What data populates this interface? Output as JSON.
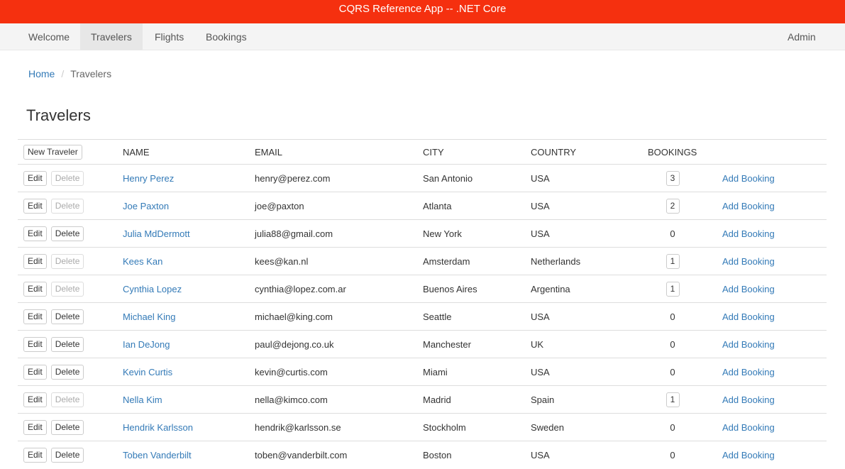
{
  "app_title": "CQRS Reference App -- .NET Core",
  "nav": {
    "items": [
      "Welcome",
      "Travelers",
      "Flights",
      "Bookings"
    ],
    "active": "Travelers",
    "user": "Admin"
  },
  "breadcrumb": {
    "home": "Home",
    "current": "Travelers"
  },
  "page_title": "Travelers",
  "table": {
    "new_button": "New Traveler",
    "headers": {
      "name": "NAME",
      "email": "EMAIL",
      "city": "CITY",
      "country": "COUNTRY",
      "bookings": "BOOKINGS"
    },
    "edit_label": "Edit",
    "delete_label": "Delete",
    "add_booking_label": "Add Booking",
    "rows": [
      {
        "name": "Henry Perez",
        "email": "henry@perez.com",
        "city": "San Antonio",
        "country": "USA",
        "bookings": "3",
        "delete_enabled": false
      },
      {
        "name": "Joe Paxton",
        "email": "joe@paxton",
        "city": "Atlanta",
        "country": "USA",
        "bookings": "2",
        "delete_enabled": false
      },
      {
        "name": "Julia MdDermott",
        "email": "julia88@gmail.com",
        "city": "New York",
        "country": "USA",
        "bookings": "0",
        "delete_enabled": true
      },
      {
        "name": "Kees Kan",
        "email": "kees@kan.nl",
        "city": "Amsterdam",
        "country": "Netherlands",
        "bookings": "1",
        "delete_enabled": false
      },
      {
        "name": "Cynthia Lopez",
        "email": "cynthia@lopez.com.ar",
        "city": "Buenos Aires",
        "country": "Argentina",
        "bookings": "1",
        "delete_enabled": false
      },
      {
        "name": "Michael King",
        "email": "michael@king.com",
        "city": "Seattle",
        "country": "USA",
        "bookings": "0",
        "delete_enabled": true
      },
      {
        "name": "Ian DeJong",
        "email": "paul@dejong.co.uk",
        "city": "Manchester",
        "country": "UK",
        "bookings": "0",
        "delete_enabled": true
      },
      {
        "name": "Kevin Curtis",
        "email": "kevin@curtis.com",
        "city": "Miami",
        "country": "USA",
        "bookings": "0",
        "delete_enabled": true
      },
      {
        "name": "Nella Kim",
        "email": "nella@kimco.com",
        "city": "Madrid",
        "country": "Spain",
        "bookings": "1",
        "delete_enabled": false
      },
      {
        "name": "Hendrik Karlsson",
        "email": "hendrik@karlsson.se",
        "city": "Stockholm",
        "country": "Sweden",
        "bookings": "0",
        "delete_enabled": true
      },
      {
        "name": "Toben Vanderbilt",
        "email": "toben@vanderbilt.com",
        "city": "Boston",
        "country": "USA",
        "bookings": "0",
        "delete_enabled": true
      }
    ]
  }
}
